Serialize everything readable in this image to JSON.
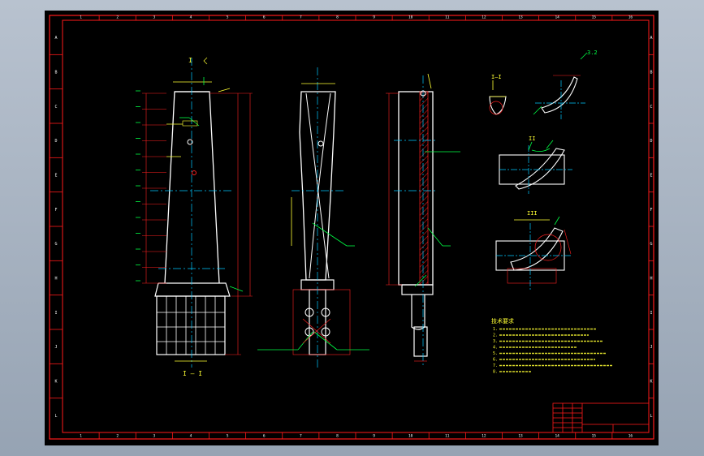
{
  "drawing": {
    "colors": {
      "background": "#000000",
      "frame": "#ff1a1a",
      "outline": "#ffffff",
      "centerline": "#00c8ff",
      "annotation": "#00ff44",
      "label": "#ffff33",
      "hatch": "#ff2020"
    },
    "zone_columns": [
      "1",
      "2",
      "3",
      "4",
      "5",
      "6",
      "7",
      "8",
      "9",
      "10",
      "11",
      "12",
      "13",
      "14",
      "15",
      "16"
    ],
    "zone_rows": [
      "A",
      "B",
      "C",
      "D",
      "E",
      "F",
      "G",
      "H",
      "I",
      "J",
      "K",
      "L"
    ],
    "view_labels": {
      "front": "I",
      "front_bottom": "I — I",
      "section_1": "I—I",
      "section_2": "II",
      "section_3": "III",
      "roughness_top": "3.2"
    },
    "notes_title": "技术要求",
    "notes": [
      "1.",
      "2.",
      "3.",
      "4.",
      "5.",
      "6.",
      "7.",
      "8."
    ]
  }
}
